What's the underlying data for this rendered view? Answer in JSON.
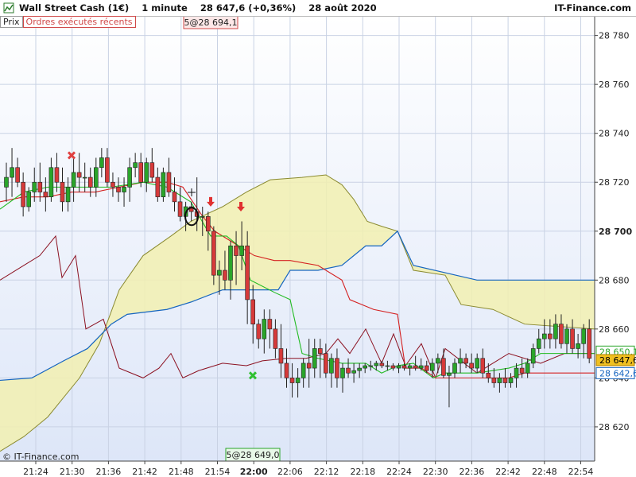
{
  "header": {
    "title": "Wall Street Cash (1€)    1 minute    28 647,6 (+0,36%)    28 août 2020",
    "brand": "IT-Finance.com"
  },
  "legend": {
    "prix": "Prix",
    "orders": "Ordres exécutés récents"
  },
  "copyright": "© IT-Finance.com",
  "colors": {
    "up": "#2aa52a",
    "down": "#d63a3a",
    "tenkan": "#d42020",
    "kijun": "#1565c0",
    "chikou": "#8b1020",
    "conversion": "#22bb22",
    "cloud": "#f2f0b0",
    "background_bottom": "#dde6f8"
  },
  "chart_data": {
    "type": "candlestick",
    "x_ticks": [
      "21:24",
      "21:30",
      "21:36",
      "21:42",
      "21:48",
      "21:54",
      "22:00",
      "22:06",
      "22:12",
      "22:18",
      "22:24",
      "22:30",
      "22:36",
      "22:42",
      "22:48",
      "22:54"
    ],
    "x_highlight": "22:00",
    "y_ticks": [
      28620,
      28640,
      28660,
      28680,
      28700,
      28720,
      28740,
      28760,
      28780
    ],
    "y_tick_labels": [
      "28 620",
      "28 640",
      "28 660",
      "28 680",
      "28 700",
      "28 720",
      "28 740",
      "28 760",
      "28 780"
    ],
    "y_bold_tick": "28 700",
    "ylim": [
      28606,
      28788
    ],
    "last_price": "28 647,6",
    "tenkan_value": "28 650,1",
    "kijun_value": "28 642,6",
    "order_labels": [
      "5@28 694,1",
      "5@28 649,0"
    ],
    "candles": [
      [
        28718,
        28728,
        28712,
        28722
      ],
      [
        28722,
        28734,
        28714,
        28726
      ],
      [
        28726,
        28730,
        28718,
        28720
      ],
      [
        28720,
        28724,
        28706,
        28710
      ],
      [
        28710,
        28718,
        28708,
        28716
      ],
      [
        28716,
        28726,
        28712,
        28720
      ],
      [
        28720,
        28728,
        28712,
        28716
      ],
      [
        28716,
        28722,
        28708,
        28714
      ],
      [
        28714,
        28730,
        28712,
        28726
      ],
      [
        28726,
        28732,
        28716,
        28720
      ],
      [
        28720,
        28726,
        28708,
        28712
      ],
      [
        28712,
        28722,
        28708,
        28718
      ],
      [
        28718,
        28730,
        28712,
        28724
      ],
      [
        28724,
        28732,
        28716,
        28722
      ],
      [
        28722,
        28728,
        28716,
        28722
      ],
      [
        28722,
        28726,
        28714,
        28718
      ],
      [
        28718,
        28730,
        28714,
        28726
      ],
      [
        28726,
        28734,
        28722,
        28730
      ],
      [
        28730,
        28734,
        28718,
        28720
      ],
      [
        28720,
        28724,
        28714,
        28718
      ],
      [
        28718,
        28722,
        28712,
        28716
      ],
      [
        28716,
        28722,
        28710,
        28718
      ],
      [
        28718,
        28730,
        28712,
        28726
      ],
      [
        28726,
        28732,
        28722,
        28728
      ],
      [
        28728,
        28732,
        28718,
        28720
      ],
      [
        28720,
        28730,
        28716,
        28728
      ],
      [
        28728,
        28734,
        28720,
        28722
      ],
      [
        28722,
        28726,
        28712,
        28714
      ],
      [
        28714,
        28726,
        28712,
        28724
      ],
      [
        28724,
        28730,
        28714,
        28716
      ],
      [
        28716,
        28722,
        28708,
        28712
      ],
      [
        28712,
        28718,
        28704,
        28706
      ],
      [
        28706,
        28712,
        28700,
        28710
      ],
      [
        28710,
        28712,
        28704,
        28708
      ],
      [
        28708,
        28722,
        28700,
        28706
      ],
      [
        28706,
        28710,
        28698,
        28706
      ],
      [
        28706,
        28708,
        28692,
        28700
      ],
      [
        28700,
        28702,
        28678,
        28682
      ],
      [
        28682,
        28688,
        28674,
        28684
      ],
      [
        28684,
        28692,
        28676,
        28680
      ],
      [
        28680,
        28696,
        28672,
        28694
      ],
      [
        28694,
        28700,
        28678,
        28690
      ],
      [
        28690,
        28704,
        28684,
        28694
      ],
      [
        28694,
        28700,
        28662,
        28672
      ],
      [
        28672,
        28678,
        28654,
        28662
      ],
      [
        28662,
        28664,
        28652,
        28656
      ],
      [
        28656,
        28668,
        28650,
        28664
      ],
      [
        28664,
        28668,
        28652,
        28660
      ],
      [
        28660,
        28664,
        28648,
        28652
      ],
      [
        28652,
        28662,
        28640,
        28646
      ],
      [
        28646,
        28652,
        28636,
        28640
      ],
      [
        28640,
        28646,
        28632,
        28638
      ],
      [
        28638,
        28644,
        28632,
        28640
      ],
      [
        28640,
        28648,
        28636,
        28646
      ],
      [
        28646,
        28656,
        28636,
        28644
      ],
      [
        28644,
        28656,
        28640,
        28652
      ],
      [
        28652,
        28656,
        28640,
        28650
      ],
      [
        28650,
        28654,
        28640,
        28642
      ],
      [
        28642,
        28650,
        28636,
        28648
      ],
      [
        28648,
        28652,
        28636,
        28640
      ],
      [
        28640,
        28646,
        28634,
        28644
      ],
      [
        28644,
        28648,
        28640,
        28642
      ],
      [
        28642,
        28646,
        28638,
        28643
      ],
      [
        28643,
        28646,
        28640,
        28644
      ],
      [
        28644,
        28646,
        28642,
        28645
      ],
      [
        28645,
        28647,
        28643,
        28645
      ],
      [
        28645,
        28647,
        28643,
        28646
      ],
      [
        28646,
        28647,
        28644,
        28645
      ],
      [
        28645,
        28647,
        28643,
        28645
      ],
      [
        28645,
        28646,
        28643,
        28644
      ],
      [
        28644,
        28646,
        28642,
        28645
      ],
      [
        28645,
        28646,
        28643,
        28644
      ],
      [
        28644,
        28646,
        28641,
        28645
      ],
      [
        28645,
        28649,
        28643,
        28644
      ],
      [
        28644,
        28648,
        28643,
        28645
      ],
      [
        28645,
        28647,
        28642,
        28643
      ],
      [
        28643,
        28648,
        28640,
        28646
      ],
      [
        28646,
        28650,
        28642,
        28648
      ],
      [
        28648,
        28652,
        28640,
        28641
      ],
      [
        28641,
        28645,
        28628,
        28642
      ],
      [
        28642,
        28648,
        28640,
        28646
      ],
      [
        28646,
        28652,
        28642,
        28648
      ],
      [
        28648,
        28650,
        28644,
        28646
      ],
      [
        28646,
        28650,
        28642,
        28644
      ],
      [
        28644,
        28650,
        28642,
        28648
      ],
      [
        28648,
        28652,
        28640,
        28642
      ],
      [
        28642,
        28646,
        28638,
        28640
      ],
      [
        28640,
        28644,
        28636,
        28638
      ],
      [
        28638,
        28642,
        28634,
        28640
      ],
      [
        28640,
        28644,
        28636,
        28638
      ],
      [
        28638,
        28642,
        28636,
        28640
      ],
      [
        28640,
        28646,
        28636,
        28644
      ],
      [
        28644,
        28648,
        28640,
        28642
      ],
      [
        28642,
        28648,
        28640,
        28646
      ],
      [
        28646,
        28654,
        28644,
        28652
      ],
      [
        28652,
        28660,
        28650,
        28656
      ],
      [
        28656,
        28664,
        28652,
        28658
      ],
      [
        28658,
        28664,
        28652,
        28656
      ],
      [
        28656,
        28666,
        28652,
        28662
      ],
      [
        28662,
        28666,
        28652,
        28654
      ],
      [
        28654,
        28662,
        28650,
        28660
      ],
      [
        28660,
        28664,
        28650,
        28652
      ],
      [
        28652,
        28658,
        28648,
        28654
      ],
      [
        28654,
        28662,
        28648,
        28660
      ],
      [
        28660,
        28664,
        28646,
        28648
      ]
    ],
    "candle_x_start": 8,
    "candle_x_step": 7.05
  }
}
